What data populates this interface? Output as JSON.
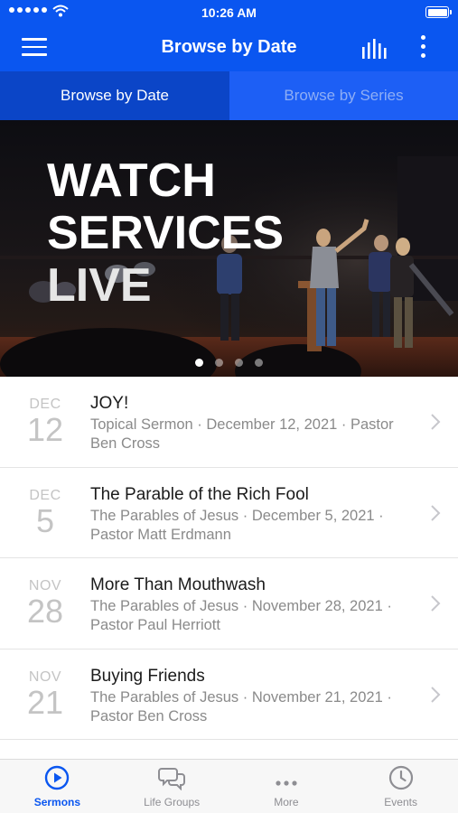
{
  "status_bar": {
    "time": "10:26 AM"
  },
  "nav": {
    "title": "Browse by Date"
  },
  "tabs": [
    {
      "label": "Browse by Date",
      "active": true
    },
    {
      "label": "Browse by Series",
      "active": false
    }
  ],
  "hero": {
    "headline": [
      "WATCH",
      "SERVICES",
      "LIVE"
    ],
    "slide_count": 4,
    "active_slide": 1
  },
  "sermons": [
    {
      "month": "DEC",
      "day": "12",
      "title": "JOY!",
      "meta": "Topical Sermon · December 12, 2021 · Pastor Ben Cross"
    },
    {
      "month": "DEC",
      "day": "5",
      "title": "The Parable of the Rich Fool",
      "meta": "The Parables of Jesus · December 5, 2021 · Pastor Matt Erdmann"
    },
    {
      "month": "NOV",
      "day": "28",
      "title": "More Than Mouthwash",
      "meta": "The Parables of Jesus · November 28, 2021 · Pastor Paul Herriott"
    },
    {
      "month": "NOV",
      "day": "21",
      "title": "Buying Friends",
      "meta": "The Parables of Jesus · November 21, 2021 · Pastor Ben Cross"
    }
  ],
  "tab_bar": [
    {
      "label": "Sermons",
      "icon": "play-circle-icon",
      "active": true
    },
    {
      "label": "Life Groups",
      "icon": "chat-bubbles-icon",
      "active": false
    },
    {
      "label": "More",
      "icon": "ellipsis-icon",
      "active": false
    },
    {
      "label": "Events",
      "icon": "clock-icon",
      "active": false
    }
  ],
  "colors": {
    "primary": "#0a56f0",
    "active_tab_bg": "#0b45c7",
    "inactive_tab_bg": "#1d5ff5",
    "muted_text": "#8a8a8a"
  }
}
